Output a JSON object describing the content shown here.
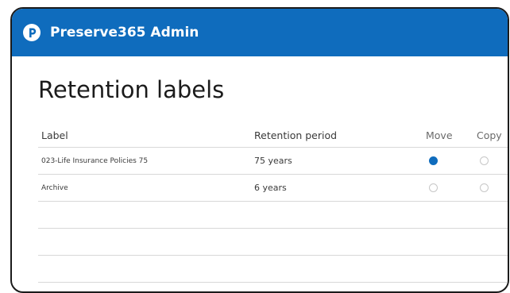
{
  "header": {
    "app_title": "Preserve365 Admin",
    "logo_icon": "preserve365-logo-icon",
    "accent_color": "#0f6cbd"
  },
  "page": {
    "title": "Retention labels"
  },
  "table": {
    "columns": {
      "label": "Label",
      "retention_period": "Retention period",
      "move": "Move",
      "copy": "Copy"
    },
    "rows": [
      {
        "label": "023-Life Insurance Policies 75",
        "retention_period": "75 years",
        "move_selected": true,
        "copy_selected": false
      },
      {
        "label": "Archive",
        "retention_period": "6 years",
        "move_selected": false,
        "copy_selected": false
      }
    ]
  }
}
